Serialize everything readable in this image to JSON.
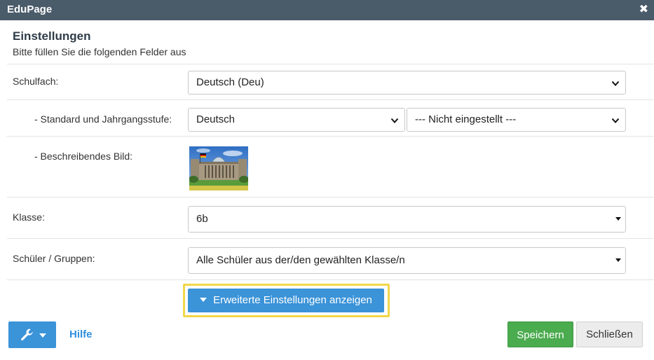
{
  "window": {
    "title": "EduPage",
    "close_glyph": "✖"
  },
  "header": {
    "title": "Einstellungen",
    "subtitle": "Bitte füllen Sie die folgenden Felder aus"
  },
  "form": {
    "subject": {
      "label": "Schulfach:",
      "value": "Deutsch (Deu)"
    },
    "standard": {
      "label": "- Standard und Jahrgangsstufe:",
      "value": "Deutsch",
      "level_value": "--- Nicht eingestellt ---"
    },
    "image": {
      "label": "- Beschreibendes Bild:"
    },
    "class": {
      "label": "Klasse:",
      "value": "6b"
    },
    "students": {
      "label": "Schüler / Gruppen:",
      "value": "Alle Schüler aus der/den gewählten Klasse/n"
    }
  },
  "advanced": {
    "label": "Erweiterte Einstellungen anzeigen"
  },
  "footer": {
    "help_label": "Hilfe",
    "save_label": "Speichern",
    "close_label": "Schließen"
  },
  "colors": {
    "titlebar": "#4a5b6a",
    "primary": "#3b93d8",
    "success": "#4bab4f",
    "highlight": "#f2d64a",
    "link": "#2f8ee0"
  }
}
